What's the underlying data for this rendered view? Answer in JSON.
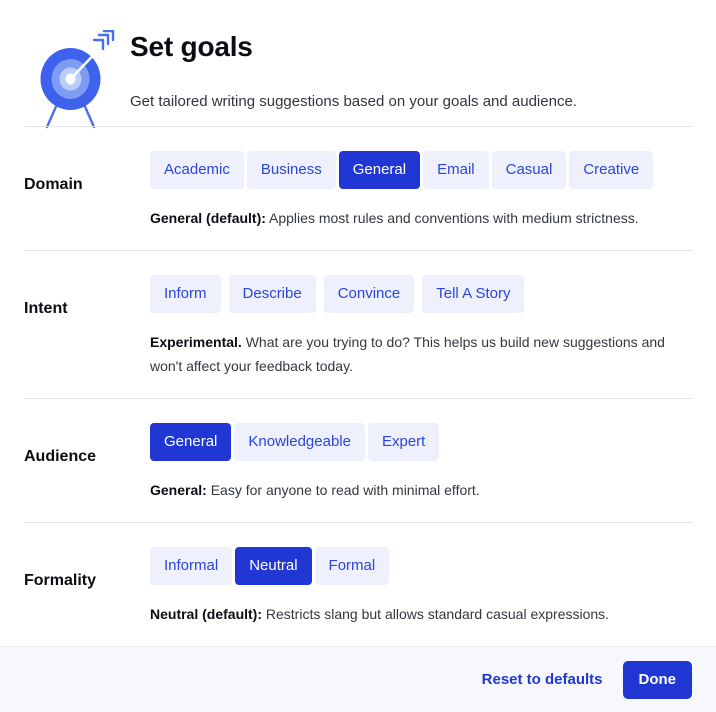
{
  "header": {
    "icon": "target-with-arrow-icon",
    "title": "Set goals",
    "subtitle": "Get tailored writing suggestions based on your goals and audience."
  },
  "colors": {
    "accent": "#2137d4",
    "chip_bg": "#eef0fb",
    "chip_text": "#2b46d8",
    "footer_bg": "#f7f8fc",
    "divider": "#e3e5ea"
  },
  "sections": [
    {
      "label": "Domain",
      "chips": [
        {
          "label": "Academic",
          "selected": false
        },
        {
          "label": "Business",
          "selected": false
        },
        {
          "label": "General",
          "selected": true
        },
        {
          "label": "Email",
          "selected": false
        },
        {
          "label": "Casual",
          "selected": false
        },
        {
          "label": "Creative",
          "selected": false
        }
      ],
      "hint_strong": "General (default):",
      "hint_text": " Applies most rules and conventions with medium strictness."
    },
    {
      "label": "Intent",
      "chips": [
        {
          "label": "Inform",
          "selected": false
        },
        {
          "label": "Describe",
          "selected": false
        },
        {
          "label": "Convince",
          "selected": false
        },
        {
          "label": "Tell A Story",
          "selected": false
        }
      ],
      "hint_strong": "Experimental.",
      "hint_text": " What are you trying to do? This helps us build new suggestions and won't affect your feedback today."
    },
    {
      "label": "Audience",
      "chips": [
        {
          "label": "General",
          "selected": true
        },
        {
          "label": "Knowledgeable",
          "selected": false
        },
        {
          "label": "Expert",
          "selected": false
        }
      ],
      "hint_strong": "General:",
      "hint_text": " Easy for anyone to read with minimal effort."
    },
    {
      "label": "Formality",
      "chips": [
        {
          "label": "Informal",
          "selected": false
        },
        {
          "label": "Neutral",
          "selected": true
        },
        {
          "label": "Formal",
          "selected": false
        }
      ],
      "hint_strong": "Neutral (default):",
      "hint_text": " Restricts slang but allows standard casual expressions."
    }
  ],
  "footer": {
    "reset_label": "Reset to defaults",
    "done_label": "Done"
  }
}
